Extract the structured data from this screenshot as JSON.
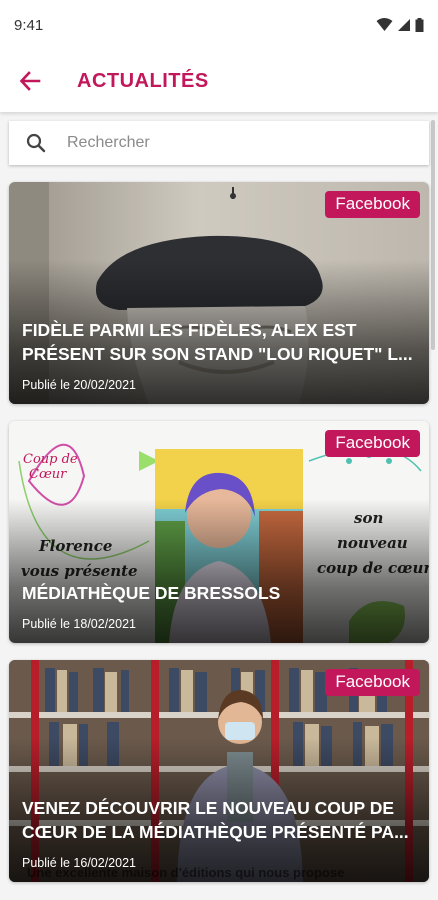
{
  "status_bar": {
    "time": "9:41"
  },
  "header": {
    "title": "ACTUALITÉS",
    "accent": "#c2185b"
  },
  "search": {
    "placeholder": "Rechercher"
  },
  "badge_color": "#c2185b",
  "news": [
    {
      "source": "Facebook",
      "title": "FIDÈLE PARMI LES FIDÈLES, ALEX EST PRÉSENT SUR SON STAND \"LOU RIQUET\" L...",
      "date": "Publié le 20/02/2021",
      "image": "man-with-beret-photo"
    },
    {
      "source": "Facebook",
      "title": "MÉDIATHÈQUE DE BRESSOLS",
      "date": "Publié le 18/02/2021",
      "image": "coup-de-coeur-poster",
      "poster_text": {
        "top_left": "Coup de Cœur",
        "left": "Florence vous présente",
        "right": "son nouveau coup de cœur"
      }
    },
    {
      "source": "Facebook",
      "title": "VENEZ DÉCOUVRIR LE NOUVEAU COUP DE CŒUR DE LA MÉDIATHÈQUE PRÉSENTÉ PA...",
      "date": "Publié le 16/02/2021",
      "image": "library-bookshelf-photo",
      "caption": "Une excellente maison d'éditions qui nous propose"
    }
  ]
}
